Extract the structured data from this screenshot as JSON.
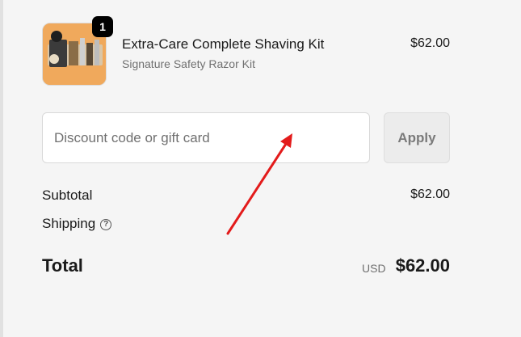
{
  "cart": {
    "quantity_badge": "1",
    "product_title": "Extra-Care Complete Shaving Kit",
    "product_variant": "Signature Safety Razor Kit",
    "product_price": "$62.00",
    "thumbnail_bg": "#f0a95c"
  },
  "discount": {
    "placeholder": "Discount code or gift card",
    "value": "",
    "apply_label": "Apply"
  },
  "summary": {
    "subtotal_label": "Subtotal",
    "subtotal_value": "$62.00",
    "shipping_label": "Shipping",
    "total_label": "Total",
    "total_currency": "USD",
    "total_value": "$62.00"
  },
  "annotation": {
    "arrow_color": "#e31b1b"
  }
}
